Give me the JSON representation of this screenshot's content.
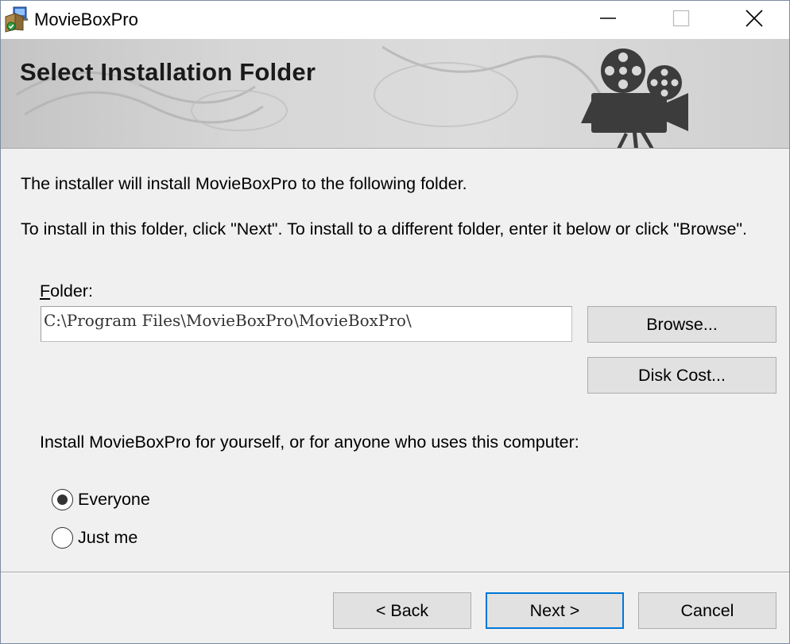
{
  "window": {
    "title": "MovieBoxPro"
  },
  "titlebar_icons": {
    "app": "installer-box-icon",
    "minimize": "minimize-icon",
    "maximize": "maximize-icon",
    "close": "close-icon"
  },
  "banner": {
    "title": "Select Installation Folder",
    "graphic": "movie-camera-icon"
  },
  "body": {
    "intro": "The installer will install MovieBoxPro to the following folder.",
    "instructions": "To install in this folder, click \"Next\". To install to a different folder, enter it below or click \"Browse\"."
  },
  "folder": {
    "label_accel": "F",
    "label_rest": "older:",
    "value": "C:\\Program Files\\MovieBoxPro\\MovieBoxPro\\",
    "browse_label": "Browse...",
    "disk_cost_label": "Disk Cost..."
  },
  "install_for": {
    "question": "Install MovieBoxPro for yourself, or for anyone who uses this computer:",
    "options": [
      {
        "label": "Everyone",
        "selected": true
      },
      {
        "label": "Just me",
        "selected": false
      }
    ]
  },
  "footer": {
    "back_label": "< Back",
    "next_label": "Next >",
    "cancel_label": "Cancel"
  },
  "colors": {
    "dialog_bg": "#f0f0f0",
    "button_bg": "#e1e1e1",
    "default_button_border": "#0078d7",
    "banner_bg": "#d6d6d6"
  }
}
